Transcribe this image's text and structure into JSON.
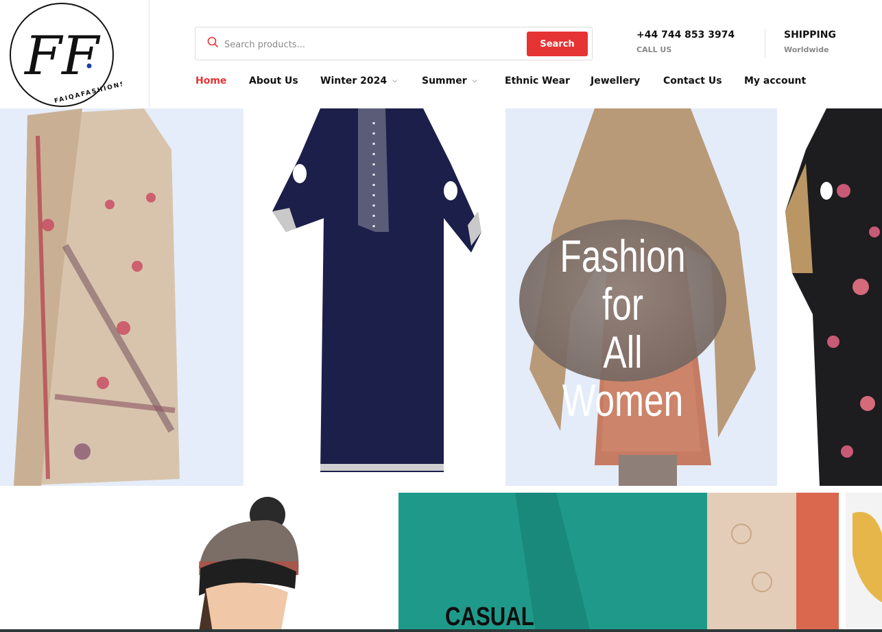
{
  "brand": {
    "monogram": "FF",
    "wordmark": "FAIQAFASHIONS"
  },
  "search": {
    "placeholder": "Search products...",
    "button_label": "Search"
  },
  "contact": {
    "phone": "+44 744 853 3974",
    "phone_label": "CALL US",
    "shipping_title": "SHIPPING",
    "shipping_label": "Worldwide"
  },
  "nav": {
    "items": [
      {
        "label": "Home",
        "active": true,
        "dropdown": false
      },
      {
        "label": "About Us",
        "active": false,
        "dropdown": false
      },
      {
        "label": "Winter 2024",
        "active": false,
        "dropdown": true
      },
      {
        "label": "Summer",
        "active": false,
        "dropdown": true
      },
      {
        "label": "Ethnic Wear",
        "active": false,
        "dropdown": false
      },
      {
        "label": "Jewellery",
        "active": false,
        "dropdown": false
      },
      {
        "label": "Contact Us",
        "active": false,
        "dropdown": false
      },
      {
        "label": "My account",
        "active": false,
        "dropdown": false
      }
    ]
  },
  "hero": {
    "headline_line1": "Fashion for",
    "headline_line2": "All Women"
  },
  "tiles": {
    "casual_label": "CASUAL"
  },
  "colors": {
    "accent": "#e63333",
    "hero_bg": "#e6edfa"
  }
}
